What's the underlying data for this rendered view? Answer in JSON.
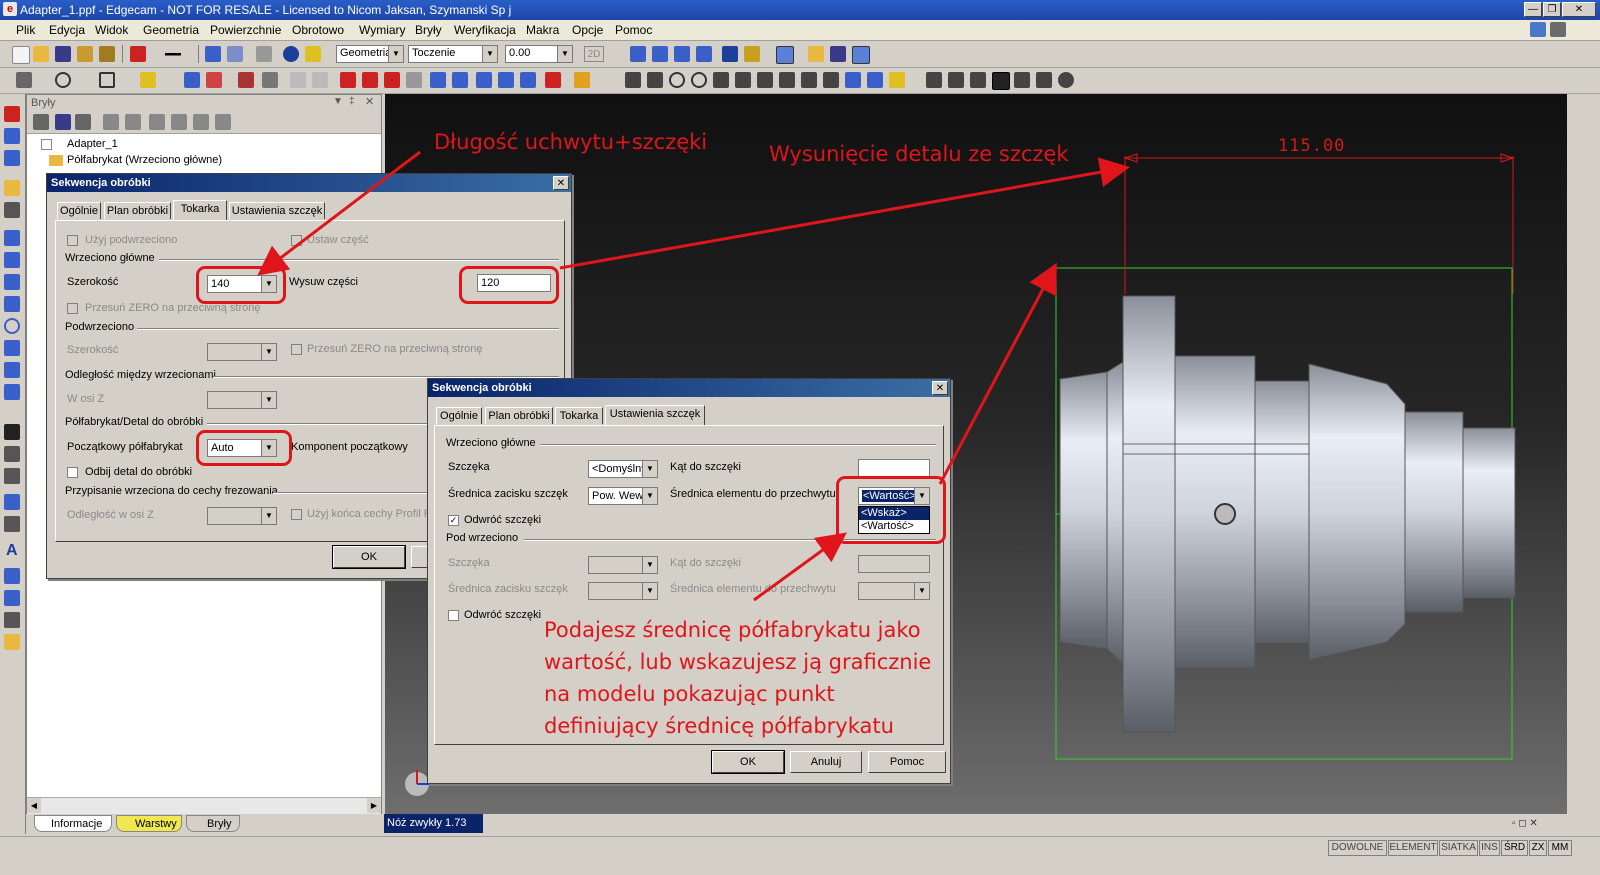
{
  "window": {
    "title": "Adapter_1.ppf - Edgecam - NOT FOR RESALE - Licensed to Nicom Jaksan, Szymanski Sp j"
  },
  "menu": [
    "Plik",
    "Edycja",
    "Widok",
    "Geometria",
    "Powierzchnie",
    "Obrotowo",
    "Wymiary",
    "Bryły",
    "Weryfikacja",
    "Makra",
    "Opcje",
    "Pomoc"
  ],
  "toolbar": {
    "mode_combo": "Geometria",
    "op_combo": "Toczenie",
    "value_combo": "0.00",
    "dim_toggle": "2D"
  },
  "panel": {
    "title": "Bryły",
    "tree": [
      "Adapter_1",
      "Półfabrykat (Wrzeciono główne)"
    ],
    "bottom_tabs": [
      "Informacje",
      "Warstwy",
      "Bryły"
    ]
  },
  "dialog1": {
    "title": "Sekwencja obróbki",
    "tabs": [
      "Ogólnie",
      "Plan obróbki",
      "Tokarka",
      "Ustawienia szczęk"
    ],
    "use_subspindle": "Użyj podwrzeciono",
    "set_part": "Ustaw część",
    "main_spindle": "Wrzeciono główne",
    "width_label": "Szerokość",
    "width_value": "140",
    "part_offset_label": "Wysuw części",
    "part_offset_value": "120",
    "shift_zero": "Przesuń ZERO na przeciwną stronę",
    "subspindle": "Podwrzeciono",
    "sub_width_label": "Szerokość",
    "sub_shift_zero": "Przesuń ZERO na przeciwną stronę",
    "spindle_distance": "Odległość między wrzecionami",
    "z_axis": "W osi Z",
    "stock_group": "Półfabrykat/Detal do obróbki",
    "initial_stock_label": "Początkowy półfabrykat",
    "initial_stock_value": "Auto",
    "initial_component": "Komponent początkowy",
    "mirror_part": "Odbij detal do obróbki",
    "assign_spindle": "Przypisanie wrzeciona do cechy frezowania",
    "z_distance": "Odległość w osi Z",
    "use_profile_end": "Użyj końca cechy Profil P",
    "ok": "OK"
  },
  "dialog2": {
    "title": "Sekwencja obróbki",
    "tabs": [
      "Ogólnie",
      "Plan obróbki",
      "Tokarka",
      "Ustawienia szczęk"
    ],
    "main_spindle": "Wrzeciono główne",
    "jaw_label": "Szczęka",
    "jaw_value": "<Domyślny",
    "jaw_angle_label": "Kąt do szczęki",
    "clamp_dia_label": "Średnica zacisku szczęk",
    "clamp_dia_value": "Pow. Wew",
    "grip_dia_label": "Średnica elementu do przechwytu",
    "grip_dia_value": "<Wartość>",
    "grip_options": [
      "<Wskaż>",
      "<Wartość>"
    ],
    "reverse_jaws": "Odwróć szczęki",
    "sub_spindle": "Pod wrzeciono",
    "sub_jaw_label": "Szczęka",
    "sub_jaw_angle_label": "Kąt do szczęki",
    "sub_clamp_dia_label": "Średnica zacisku szczęk",
    "sub_grip_dia_label": "Średnica elementu do przechwytu",
    "sub_reverse_jaws": "Odwróć szczęki",
    "ok": "OK",
    "cancel": "Anuluj",
    "help": "Pomoc"
  },
  "annotations": {
    "chuck_length": "Długość uchwytu+szczęki",
    "part_offset": "Wysunięcie detalu ze szczęk",
    "stock_diameter": [
      "Podajesz średnicę półfabrykatu jako",
      "wartość, lub wskazujesz ją graficznie",
      "na modelu pokazując punkt",
      "definiujący średnicę półfabrykatu"
    ]
  },
  "viewport": {
    "dimension": "115.00"
  },
  "status": {
    "tool": "Nóż zwykły 1.73",
    "indicators": [
      "DOWOLNE",
      "ELEMENT",
      "SIATKA",
      "INS",
      "ŚRD",
      "ZX",
      "MM"
    ]
  },
  "colors": {
    "annotation_red": "#e0151b",
    "title_blue": "#1c45a6",
    "stock_green": "#2fd12f"
  }
}
